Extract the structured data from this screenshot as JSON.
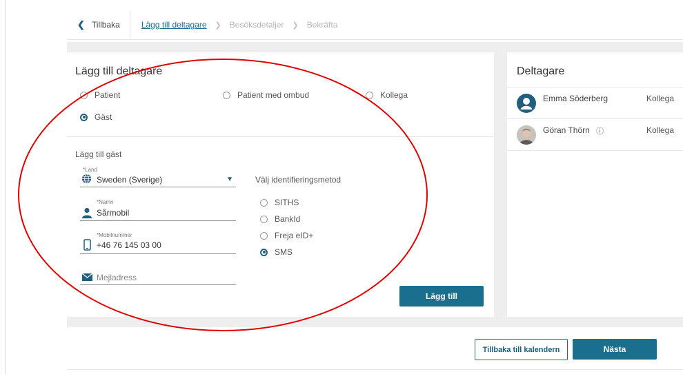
{
  "nav": {
    "back_label": "Tillbaka",
    "steps": [
      "Lägg till deltagare",
      "Besöksdetaljer",
      "Bekräfta"
    ]
  },
  "add_participant": {
    "title": "Lägg till deltagare",
    "roles": [
      {
        "label": "Patient",
        "checked": false
      },
      {
        "label": "Patient med ombud",
        "checked": false
      },
      {
        "label": "Kollega",
        "checked": false
      },
      {
        "label": "Gäst",
        "checked": true
      }
    ]
  },
  "guest_form": {
    "section_title": "Lägg till gäst",
    "country": {
      "label": "*Land",
      "value": "Sweden (Sverige)"
    },
    "name": {
      "label": "*Namn",
      "value": "Sårmobil"
    },
    "mobile": {
      "label": "*Mobilnummer",
      "value": "+46 76 145 03 00"
    },
    "email": {
      "placeholder": "Mejladress",
      "value": ""
    },
    "id_method_title": "Välj identifieringsmetod",
    "id_methods": [
      {
        "label": "SITHS",
        "checked": false
      },
      {
        "label": "BankId",
        "checked": false
      },
      {
        "label": "Freja eID+",
        "checked": false
      },
      {
        "label": "SMS",
        "checked": true
      }
    ],
    "add_button_label": "Lägg till"
  },
  "participants": {
    "title": "Deltagare",
    "list": [
      {
        "name": "Emma Söderberg",
        "role": "Kollega"
      },
      {
        "name": "Göran Thörn",
        "role": "Kollega"
      }
    ]
  },
  "footer": {
    "back_to_calendar_label": "Tillbaka till kalendern",
    "next_label": "Nästa"
  },
  "colors": {
    "accent": "#1a6e8e",
    "annotation": "#e00000"
  }
}
